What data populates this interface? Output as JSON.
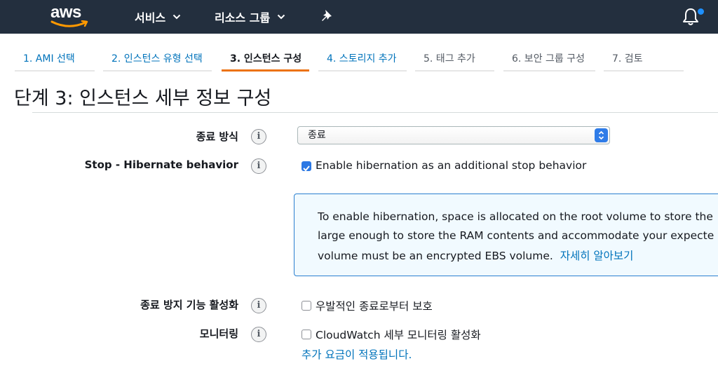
{
  "nav": {
    "logo_text": "aws",
    "services_label": "서비스",
    "resource_groups_label": "리소스 그룹",
    "icons": [
      "chevron-down-icon",
      "pin-icon",
      "bell-icon"
    ],
    "notification_dot_color": "#1e90ff"
  },
  "steps": [
    {
      "label": "1. AMI 선택",
      "state": "done"
    },
    {
      "label": "2. 인스턴스 유형 선택",
      "state": "done"
    },
    {
      "label": "3. 인스턴스 구성",
      "state": "active"
    },
    {
      "label": "4. 스토리지 추가",
      "state": "link"
    },
    {
      "label": "5. 태그 추가",
      "state": "future"
    },
    {
      "label": "6. 보안 그룹 구성",
      "state": "future"
    },
    {
      "label": "7. 검토",
      "state": "future"
    }
  ],
  "page": {
    "title": "단계 3: 인스턴스 세부 정보 구성"
  },
  "form": {
    "shutdown": {
      "label": "종료 방식",
      "value": "종료"
    },
    "hibernate": {
      "label": "Stop - Hibernate behavior",
      "checkbox_label": "Enable hibernation as an additional stop behavior",
      "checked": true,
      "info_lines": [
        "To enable hibernation, space is allocated on the root volume to store the",
        "large enough to store the RAM contents and accommodate your expecte",
        "volume must be an encrypted EBS volume."
      ],
      "learn_more": "자세히 알아보기"
    },
    "termination_protection": {
      "label": "종료 방지 기능 활성화",
      "checkbox_label": "우발적인 종료로부터 보호",
      "checked": false
    },
    "monitoring": {
      "label": "모니터링",
      "checkbox_label": "CloudWatch 세부 모니터링 활성화",
      "checked": false,
      "cost_link": "추가 요금이 적용됩니다."
    }
  },
  "colors": {
    "nav_bg": "#232f3e",
    "accent": "#ec7211",
    "link": "#0073bb",
    "checkbox": "#2b78e4"
  }
}
